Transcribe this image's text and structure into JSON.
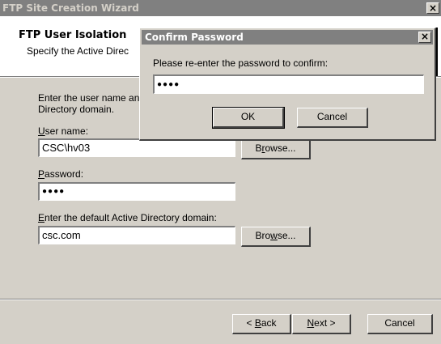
{
  "window": {
    "title": "FTP Site Creation Wizard",
    "close_glyph": "×"
  },
  "header": {
    "title": "FTP User Isolation",
    "subtitle": "Specify the Active Direc"
  },
  "body": {
    "instructions_line1": "Enter the user name an",
    "instructions_line2": "Directory domain.",
    "username_label_key": "U",
    "username_label_rest": "ser name:",
    "username_value": "CSC\\hv03",
    "browse1_prefix": "B",
    "browse1_key": "r",
    "browse1_suffix": "owse...",
    "password_label_key": "P",
    "password_label_rest": "assword:",
    "password_value": "●●●●",
    "domain_label_key": "E",
    "domain_label_rest": "nter the default Active Directory domain:",
    "domain_value": "csc.com",
    "browse2_prefix": "Bro",
    "browse2_key": "w",
    "browse2_suffix": "se..."
  },
  "footer": {
    "back_prefix": "< ",
    "back_key": "B",
    "back_suffix": "ack",
    "next_key": "N",
    "next_suffix": "ext >",
    "cancel_label": "Cancel"
  },
  "dialog": {
    "title": "Confirm Password",
    "close_glyph": "×",
    "prompt": "Please re-enter the password to confirm:",
    "password_value": "●●●●",
    "ok_label": "OK",
    "cancel_label": "Cancel"
  }
}
